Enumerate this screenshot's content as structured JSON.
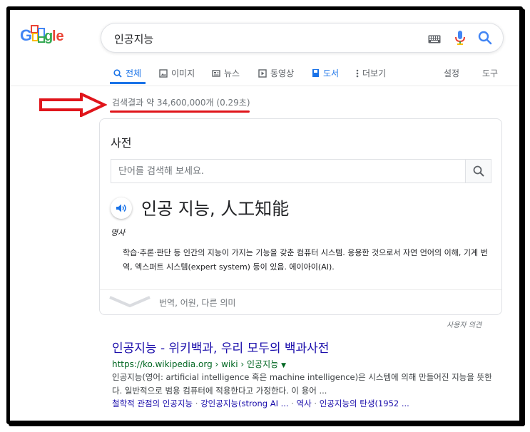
{
  "colors": {
    "accent": "#1a73e8",
    "link": "#1a0dab",
    "url_green": "#006621",
    "annotation_red": "#e0151b",
    "muted": "#70757a"
  },
  "logo": {
    "alt": "Google"
  },
  "search": {
    "query": "인공지능"
  },
  "tabs": [
    {
      "label": "전체",
      "icon": "search-icon",
      "active": true
    },
    {
      "label": "이미지",
      "icon": "image-icon"
    },
    {
      "label": "뉴스",
      "icon": "news-icon"
    },
    {
      "label": "동영상",
      "icon": "play-icon"
    },
    {
      "label": "도서",
      "icon": "book-icon"
    },
    {
      "label": "더보기",
      "icon": "more-vert-icon"
    }
  ],
  "tools": {
    "settings": "설정",
    "tools": "도구"
  },
  "stats": "검색결과 약 34,600,000개 (0.29초)",
  "dictionary": {
    "title": "사전",
    "input_placeholder": "단어를 검색해 보세요.",
    "headword": "인공 지능, 人工知能",
    "pos": "명사",
    "definition": "학습·추론·판단 등 인간의 지능이 가지는 기능을 갖춘 컴퓨터 시스템. 응용한 것으로서 자연 언어의 이해, 기계 번역, 엑스퍼트 시스템(expert system) 등이 있음. 에이아이(AI).",
    "more": "번역, 어원, 다른 의미"
  },
  "feedback": "사용자 의견",
  "result": {
    "title": "인공지능 - 위키백과, 우리 모두의 백과사전",
    "url": "https://ko.wikipedia.org › wiki › 인공지능",
    "snippet": "인공지능(영어: artificial intelligence 혹은 machine intelligence)은 시스템에 의해 만들어진 지능을 뜻한다. 일반적으로 범용 컴퓨터에 적용한다고 가정한다. 이 용어 ...",
    "links": [
      "철학적 관점의 인공지능",
      "강인공지능(strong AI ...",
      "역사",
      "인공지능의 탄생(1952 ..."
    ],
    "link_sep": " · "
  }
}
